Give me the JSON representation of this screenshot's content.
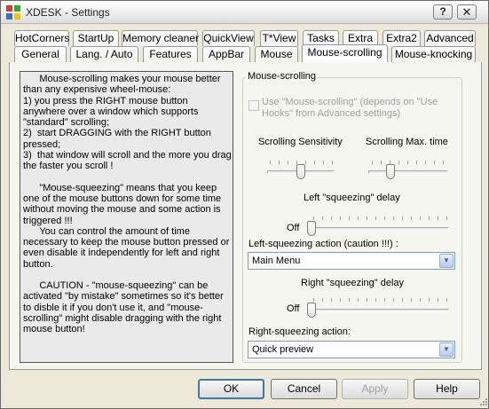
{
  "window": {
    "title": "XDESK - Settings",
    "help_button": "?",
    "close_button": "✕"
  },
  "tabs_row1": [
    "HotCorners",
    "StartUp",
    "Memory cleaner",
    "QuickView",
    "T*View",
    "Tasks",
    "Extra",
    "Extra2",
    "Advanced"
  ],
  "tabs_row2": [
    "General",
    "Lang. / Auto",
    "Features",
    "AppBar",
    "Mouse",
    "Mouse-scrolling",
    "Mouse-knocking"
  ],
  "active_tab": "Mouse-scrolling",
  "info_paragraphs": [
    "      Mouse-scrolling makes your mouse better than any expensive wheel-mouse:\n1) you press the RIGHT mouse button anywhere over a window which supports \"standard\" scrolling;\n2)  start DRAGGING with the RIGHT button pressed;\n3)  that window will scroll and the more you drag the faster you scroll !",
    "      \"Mouse-squeezing\" means that you keep one of the mouse buttons down for some time without moving the mouse and some action is triggered !!!\n      You can control the amount of time necessary to keep the mouse button pressed or even disable it independently for left and right button.",
    "      CAUTION - \"mouse-squeezing\" can be activated \"by mistake\" sometimes so it's better to disble it if you don't use it, and \"mouse-scrolling\" might disable dragging with the right mouse button!"
  ],
  "group": {
    "title": "Mouse-scrolling",
    "use_checkbox_label": "Use \"Mouse-scrolling\" (depends on \"Use Hooks\" from Advanced settings)",
    "use_checkbox_checked": false,
    "scroll_sensitivity_label": "Scrolling Sensitivity",
    "scroll_sensitivity_level": 0.5,
    "scroll_max_time_label": "Scrolling Max. time",
    "scroll_max_time_level": 0.25,
    "left_delay_label": "Left \"squeezing\" delay",
    "left_delay_off": "Off",
    "left_delay_level": 0,
    "left_action_label": "Left-squeezing action (caution !!!) :",
    "left_action_value": "Main Menu",
    "right_delay_label": "Right \"squeezing\" delay",
    "right_delay_off": "Off",
    "right_delay_level": 0,
    "right_action_label": "Right-squeezing action:",
    "right_action_value": "Quick preview"
  },
  "buttons": {
    "ok": "OK",
    "cancel": "Cancel",
    "apply": "Apply",
    "help": "Help"
  },
  "colors": {
    "title_bar": "#f1f1f1",
    "dialog_bg": "#ece9d8",
    "tab_border": "#919b9c",
    "default_button_border": "#3d7bad"
  }
}
